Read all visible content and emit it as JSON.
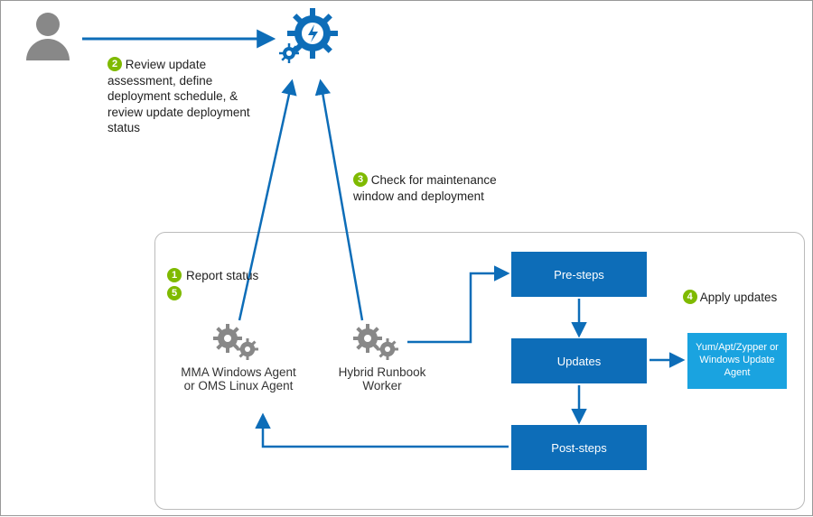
{
  "steps": {
    "s1": {
      "num": "1"
    },
    "s2": {
      "num": "2",
      "text": "Review update assessment, define deployment schedule, & review update deployment status"
    },
    "s3": {
      "num": "3",
      "text": "Check for maintenance window and deployment"
    },
    "s4": {
      "num": "4",
      "text": "Apply updates"
    },
    "s5": {
      "num": "5"
    },
    "report": "Report status"
  },
  "nodes": {
    "mma": "MMA Windows Agent or OMS Linux Agent",
    "hybrid": "Hybrid Runbook Worker",
    "pre": "Pre-steps",
    "updates": "Updates",
    "post": "Post-steps",
    "agent": "Yum/Apt/Zypper or Windows Update Agent"
  },
  "colors": {
    "arrow": "#0d6db8",
    "badge": "#7fba00",
    "box": "#0d6db8",
    "box_light": "#1aa3e0",
    "gear_grey": "#888"
  }
}
